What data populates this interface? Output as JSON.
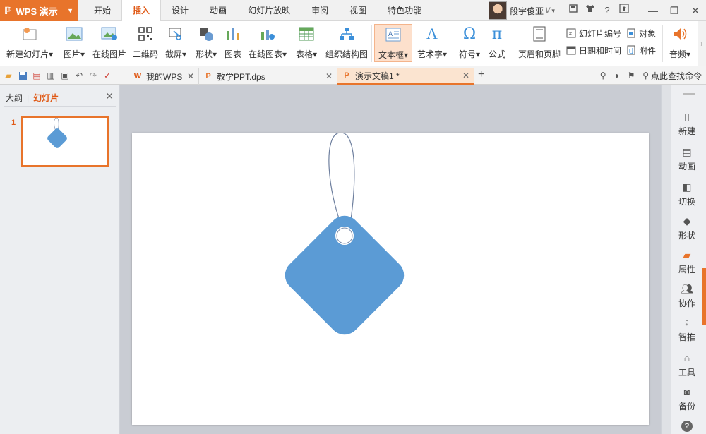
{
  "app": {
    "name": "WPS 演示"
  },
  "menu": {
    "items": [
      "开始",
      "插入",
      "设计",
      "动画",
      "幻灯片放映",
      "审阅",
      "视图",
      "特色功能"
    ],
    "active": "插入"
  },
  "user": {
    "name": "段宇俊亚",
    "vip": "V"
  },
  "title_icons": [
    "skin-icon",
    "shirt-icon",
    "help-icon",
    "upload-icon"
  ],
  "ribbon": {
    "new_slide": "新建幻灯片",
    "picture": "图片",
    "online_picture": "在线图片",
    "qrcode": "二维码",
    "screenshot": "截屏",
    "shape": "形状",
    "chart": "图表",
    "online_chart": "在线图表",
    "table": "表格",
    "smartart": "组织结构图",
    "textbox": "文本框",
    "wordart": "艺术字",
    "symbol": "符号",
    "formula": "公式",
    "header_footer": "页眉和页脚",
    "slide_number": "幻灯片编号",
    "date_time": "日期和时间",
    "object": "对象",
    "attachment": "附件",
    "audio": "音频",
    "dropdown_glyph": "▾"
  },
  "tabs": [
    {
      "label": "我的WPS",
      "icon": "W"
    },
    {
      "label": "教学PPT.dps",
      "icon": "P"
    },
    {
      "label": "演示文稿1 *",
      "icon": "P"
    }
  ],
  "tabbar": {
    "search_label": "点此查找命令"
  },
  "leftpanel": {
    "outline": "大纲",
    "divider": "|",
    "slides": "幻灯片",
    "slide_number": "1"
  },
  "rightpane": {
    "items": [
      "新建",
      "动画",
      "切换",
      "形状",
      "属性",
      "协作",
      "智推",
      "工具",
      "备份"
    ],
    "help": "?"
  },
  "colors": {
    "accent": "#e8742b",
    "tag_fill": "#5b9bd5",
    "string": "#6e7f9e"
  }
}
